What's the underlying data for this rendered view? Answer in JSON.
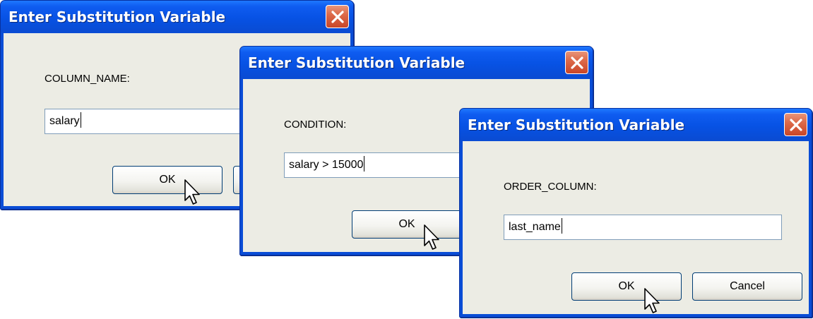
{
  "dialogs": [
    {
      "title": "Enter Substitution Variable",
      "label": "COLUMN_NAME:",
      "value": "salary",
      "ok_label": "OK",
      "cancel_label": ""
    },
    {
      "title": "Enter Substitution Variable",
      "label": "CONDITION:",
      "value": "salary > 15000",
      "ok_label": "OK",
      "cancel_label": ""
    },
    {
      "title": "Enter Substitution Variable",
      "label": "ORDER_COLUMN:",
      "value": "last_name",
      "ok_label": "OK",
      "cancel_label": "Cancel"
    }
  ],
  "icons": {
    "close": "close-icon",
    "pointer": "mouse-pointer-icon"
  },
  "colors": {
    "titlebar": "#0a4dd6",
    "client": "#ecece4",
    "close_button": "#d9623f",
    "input_border": "#7f9db9",
    "button_border": "#003c74"
  }
}
